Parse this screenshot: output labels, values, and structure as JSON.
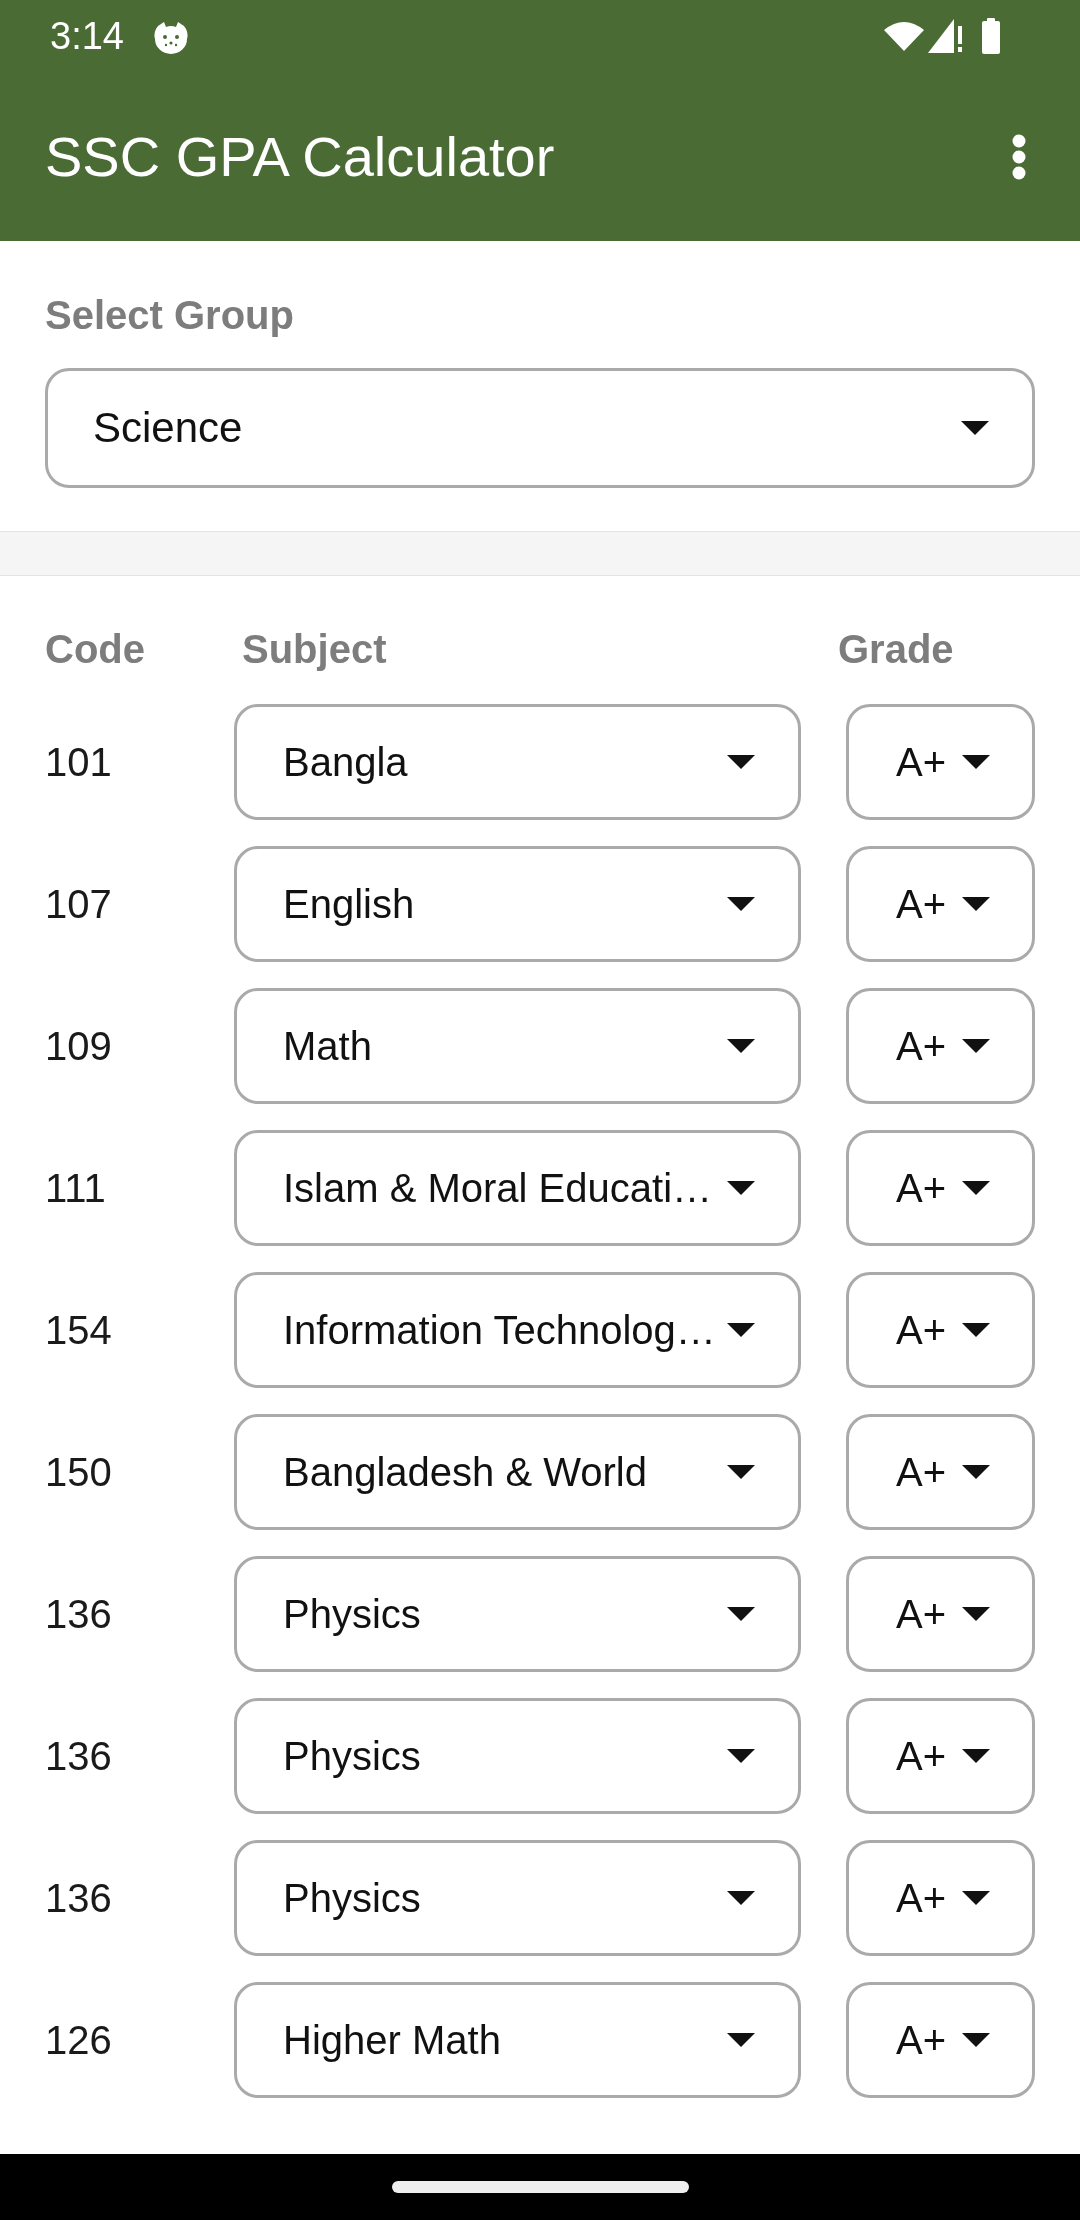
{
  "status_bar": {
    "time": "3:14"
  },
  "app_bar": {
    "title": "SSC GPA Calculator"
  },
  "group": {
    "label": "Select Group",
    "value": "Science"
  },
  "subjects": {
    "columns": [
      "Code",
      "Subject",
      "Grade"
    ],
    "rows": [
      {
        "code": "101",
        "subject": "Bangla",
        "grade": "A+"
      },
      {
        "code": "107",
        "subject": "English",
        "grade": "A+"
      },
      {
        "code": "109",
        "subject": "Math",
        "grade": "A+"
      },
      {
        "code": "111",
        "subject": "Islam & Moral Educati…",
        "grade": "A+"
      },
      {
        "code": "154",
        "subject": "Information Technolog…",
        "grade": "A+"
      },
      {
        "code": "150",
        "subject": "Bangladesh & World",
        "grade": "A+"
      },
      {
        "code": "136",
        "subject": "Physics",
        "grade": "A+"
      },
      {
        "code": "136",
        "subject": "Physics",
        "grade": "A+"
      },
      {
        "code": "136",
        "subject": "Physics",
        "grade": "A+"
      },
      {
        "code": "126",
        "subject": "Higher Math",
        "grade": "A+"
      }
    ]
  }
}
